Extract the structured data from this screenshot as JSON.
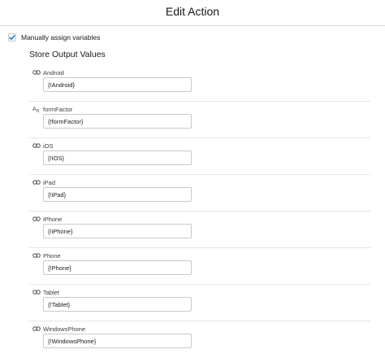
{
  "header": {
    "title": "Edit Action"
  },
  "manual_assign": {
    "label": "Manually assign variables",
    "checked": true
  },
  "section": {
    "title": "Store Output Values"
  },
  "outputs": [
    {
      "label": "Android",
      "value": "{!Android}",
      "icon": "boolean-icon"
    },
    {
      "label": "formFactor",
      "value": "{!formFactor}",
      "icon": "text-icon"
    },
    {
      "label": "iOS",
      "value": "{!IOS}",
      "icon": "boolean-icon"
    },
    {
      "label": "iPad",
      "value": "{!iPad}",
      "icon": "boolean-icon"
    },
    {
      "label": "iPhone",
      "value": "{!iPhone}",
      "icon": "boolean-icon"
    },
    {
      "label": "Phone",
      "value": "{!Phone}",
      "icon": "boolean-icon"
    },
    {
      "label": "Tablet",
      "value": "{!Tablet}",
      "icon": "boolean-icon"
    },
    {
      "label": "WindowsPhone",
      "value": "{!WindowsPhone}",
      "icon": "boolean-icon"
    }
  ],
  "colors": {
    "accent": "#0176d3",
    "border": "#c9c9c9",
    "divider": "#e5e5e5"
  }
}
